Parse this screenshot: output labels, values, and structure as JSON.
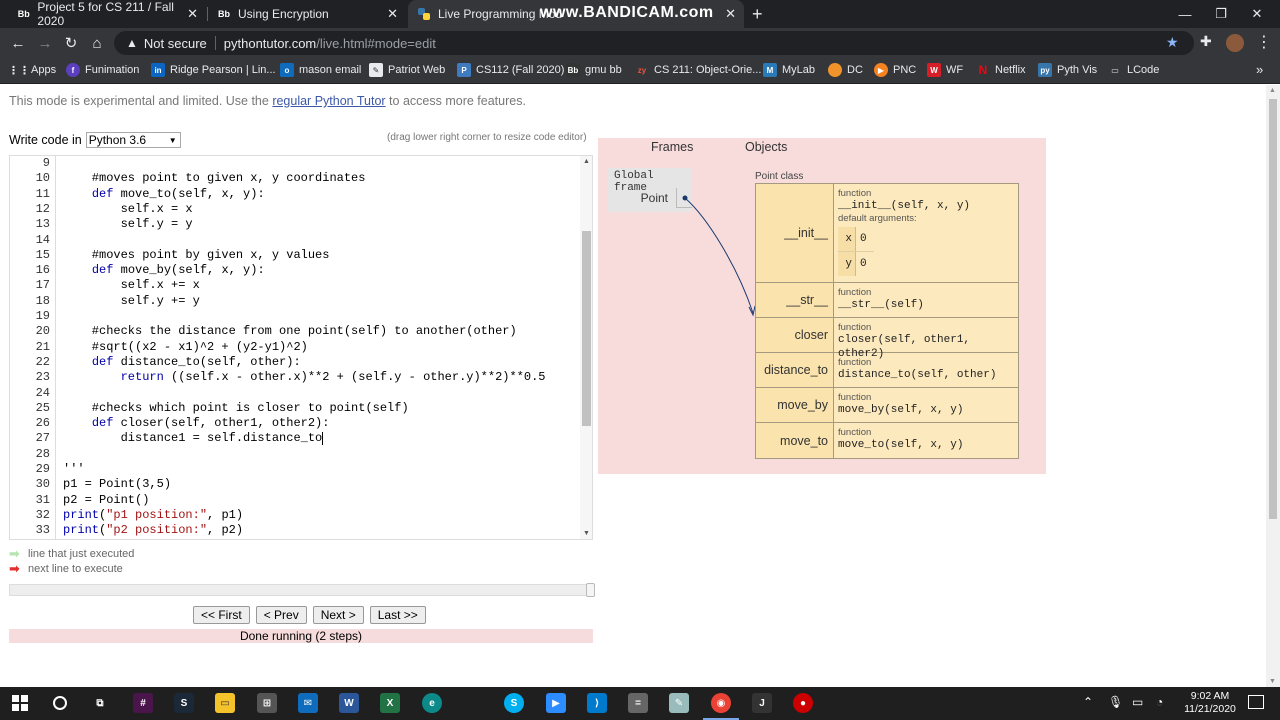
{
  "browser": {
    "tabs": [
      {
        "favicon": "Bb",
        "title": "Project 5 for CS 211 / Fall 2020"
      },
      {
        "favicon": "Bb",
        "title": "Using Encryption"
      },
      {
        "favicon": "python-icon",
        "title": "Live Programming Mod"
      }
    ],
    "overlay_watermark": "www.BANDICAM.com",
    "security_label": "Not secure",
    "url_host": "pythontutor.com",
    "url_path": "/live.html#mode=edit",
    "bookmarks": [
      {
        "label": "Apps",
        "icon": "apps-grid-icon",
        "color": "#e8eaed"
      },
      {
        "label": "Funimation",
        "icon": "funimation-icon",
        "color": "#5b3fbf"
      },
      {
        "label": "Ridge Pearson | Lin...",
        "icon": "linkedin-icon",
        "color": "#0a66c2"
      },
      {
        "label": "mason email",
        "icon": "outlook-icon",
        "color": "#0f6cbd"
      },
      {
        "label": "Patriot Web",
        "icon": "patriot-icon",
        "color": "#e8eaed"
      },
      {
        "label": "CS112 (Fall 2020)",
        "icon": "piazza-icon",
        "color": "#3e7bbf"
      },
      {
        "label": "gmu bb",
        "icon": "blackboard-icon",
        "color": "#333333"
      },
      {
        "label": "CS 211: Object-Orie...",
        "icon": "zybooks-icon",
        "color": "#e8553e"
      },
      {
        "label": "MyLab",
        "icon": "mylab-icon",
        "color": "#2a7ab8"
      },
      {
        "label": "DC",
        "icon": "dc-icon",
        "color": "#f0932b"
      },
      {
        "label": "PNC",
        "icon": "pnc-icon",
        "color": "#f58220"
      },
      {
        "label": "WF",
        "icon": "wf-icon",
        "color": "#d71e28"
      },
      {
        "label": "Netflix",
        "icon": "netflix-icon",
        "color": "#e50914"
      },
      {
        "label": "Pyth Vis",
        "icon": "python-icon",
        "color": "#3776ab"
      },
      {
        "label": "LCode",
        "icon": "leetcode-icon",
        "color": "#e8eaed"
      }
    ]
  },
  "page": {
    "notice_prefix": "This mode is experimental and limited. Use the ",
    "notice_link": "regular Python Tutor",
    "notice_suffix": " to access more features.",
    "write_code_label": "Write code in",
    "language_selected": "Python 3.6",
    "resize_hint": "(drag lower right corner to resize code editor)",
    "legend_executed": "line that just executed",
    "legend_next": "next line to execute",
    "nav": {
      "first": "<< First",
      "prev": "< Prev",
      "next": "Next >",
      "last": "Last >>"
    },
    "status": "Done running (2 steps)"
  },
  "code_lines": [
    {
      "n": "9",
      "text": ""
    },
    {
      "n": "10",
      "text": "    #moves point to given x, y coordinates",
      "type": "comment"
    },
    {
      "n": "11",
      "text": "    def move_to(self, x, y):",
      "type": "def"
    },
    {
      "n": "12",
      "text": "        self.x = x"
    },
    {
      "n": "13",
      "text": "        self.y = y"
    },
    {
      "n": "14",
      "text": ""
    },
    {
      "n": "15",
      "text": "    #moves point by given x, y values",
      "type": "comment"
    },
    {
      "n": "16",
      "text": "    def move_by(self, x, y):",
      "type": "def"
    },
    {
      "n": "17",
      "text": "        self.x += x"
    },
    {
      "n": "18",
      "text": "        self.y += y"
    },
    {
      "n": "19",
      "text": ""
    },
    {
      "n": "20",
      "text": "    #checks the distance from one point(self) to another(other)",
      "type": "comment"
    },
    {
      "n": "21",
      "text": "    #sqrt((x2 - x1)^2 + (y2-y1)^2)",
      "type": "comment"
    },
    {
      "n": "22",
      "text": "    def distance_to(self, other):",
      "type": "def"
    },
    {
      "n": "23",
      "text": "        return ((self.x - other.x)**2 + (self.y - other.y)**2)**0.5",
      "type": "return"
    },
    {
      "n": "24",
      "text": ""
    },
    {
      "n": "25",
      "text": "    #checks which point is closer to point(self)",
      "type": "comment"
    },
    {
      "n": "26",
      "text": "    def closer(self, other1, other2):",
      "type": "def"
    },
    {
      "n": "27",
      "text": "        distance1 = self.distance_to",
      "type": "cursor"
    },
    {
      "n": "28",
      "text": ""
    },
    {
      "n": "29",
      "text": "'''",
      "type": "string"
    },
    {
      "n": "30",
      "text": "p1 = Point(3,5)"
    },
    {
      "n": "31",
      "text": "p2 = Point()"
    },
    {
      "n": "32",
      "text": "print(\"p1 position:\", p1)",
      "type": "print"
    },
    {
      "n": "33",
      "text": "print(\"p2 position:\", p2)",
      "type": "print"
    }
  ],
  "visualization": {
    "frames_header": "Frames",
    "objects_header": "Objects",
    "global_frame": "Global frame",
    "frame_var": "Point",
    "class_label": "Point class",
    "class_rows": [
      {
        "key": "__init__",
        "type": "function",
        "sig": "__init__(self, x, y)",
        "defaults_label": "default arguments:",
        "defaults": [
          {
            "k": "x",
            "v": "0"
          },
          {
            "k": "y",
            "v": "0"
          }
        ]
      },
      {
        "key": "__str__",
        "type": "function",
        "sig": "__str__(self)"
      },
      {
        "key": "closer",
        "type": "function",
        "sig": "closer(self, other1, other2)"
      },
      {
        "key": "distance_to",
        "type": "function",
        "sig": "distance_to(self, other)"
      },
      {
        "key": "move_by",
        "type": "function",
        "sig": "move_by(self, x, y)"
      },
      {
        "key": "move_to",
        "type": "function",
        "sig": "move_to(self, x, y)"
      }
    ]
  },
  "taskbar": {
    "time": "9:02 AM",
    "date": "11/21/2020",
    "apps": [
      "windows-start-icon",
      "search-circle-icon",
      "task-view-icon",
      "slack-icon",
      "steam-icon",
      "file-explorer-icon",
      "store-icon",
      "mail-icon",
      "word-icon",
      "excel-icon",
      "edge-icon",
      "skype-icon",
      "zoom-icon",
      "vscode-icon",
      "calculator-icon",
      "notepad-icon",
      "chrome-icon",
      "jgrasp-icon",
      "bandicam-record-icon"
    ]
  }
}
